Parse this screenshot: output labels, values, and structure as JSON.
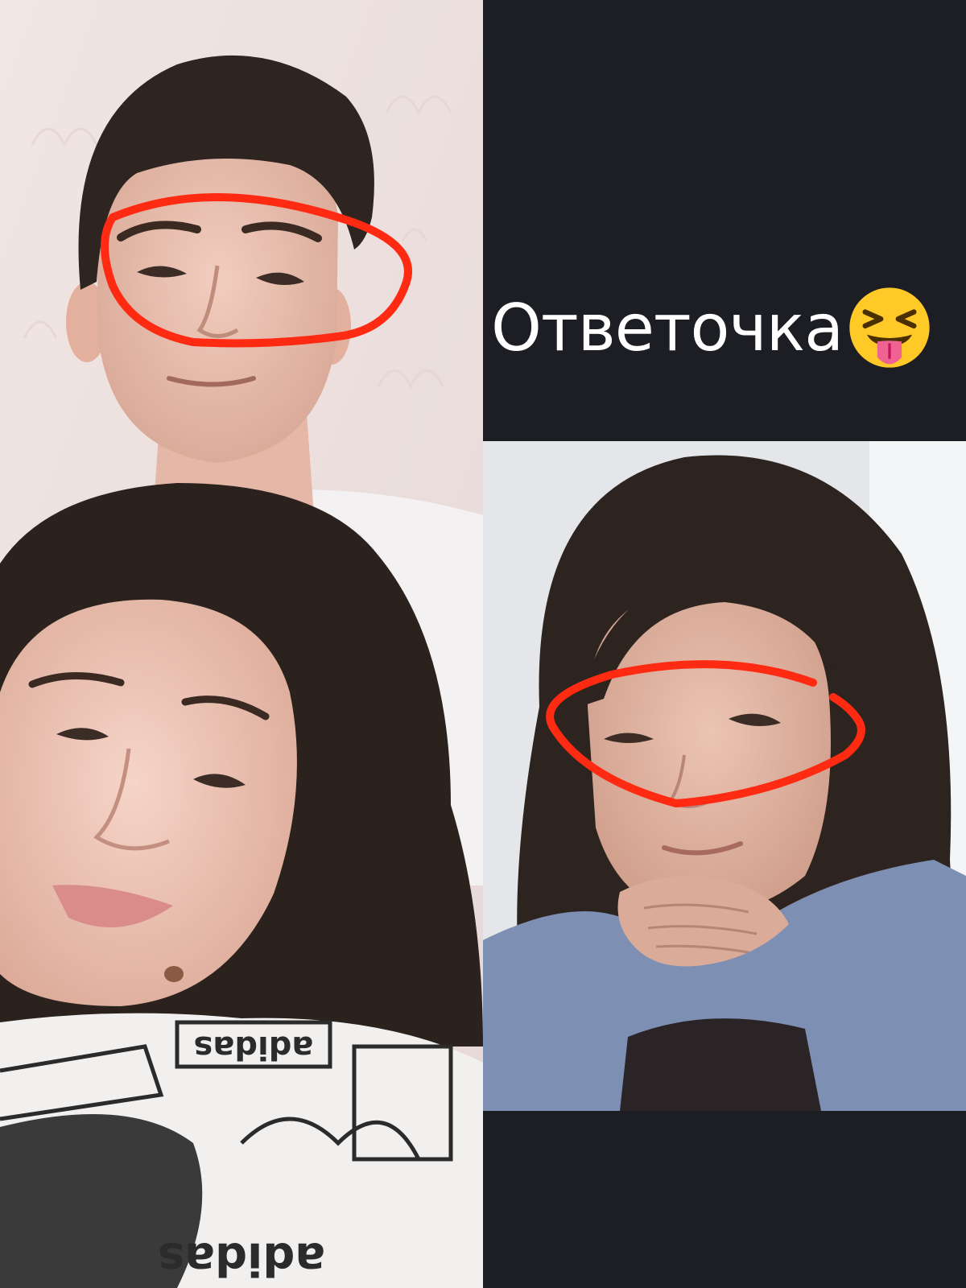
{
  "caption": {
    "text": "Ответочка"
  },
  "emoji": {
    "icon": "squinting-face-with-tongue-icon"
  },
  "annotation_color": "#ff2a12",
  "background_color": "#1c1e24",
  "shirt_text": {
    "top": "adidas",
    "bottom": "adidas"
  }
}
